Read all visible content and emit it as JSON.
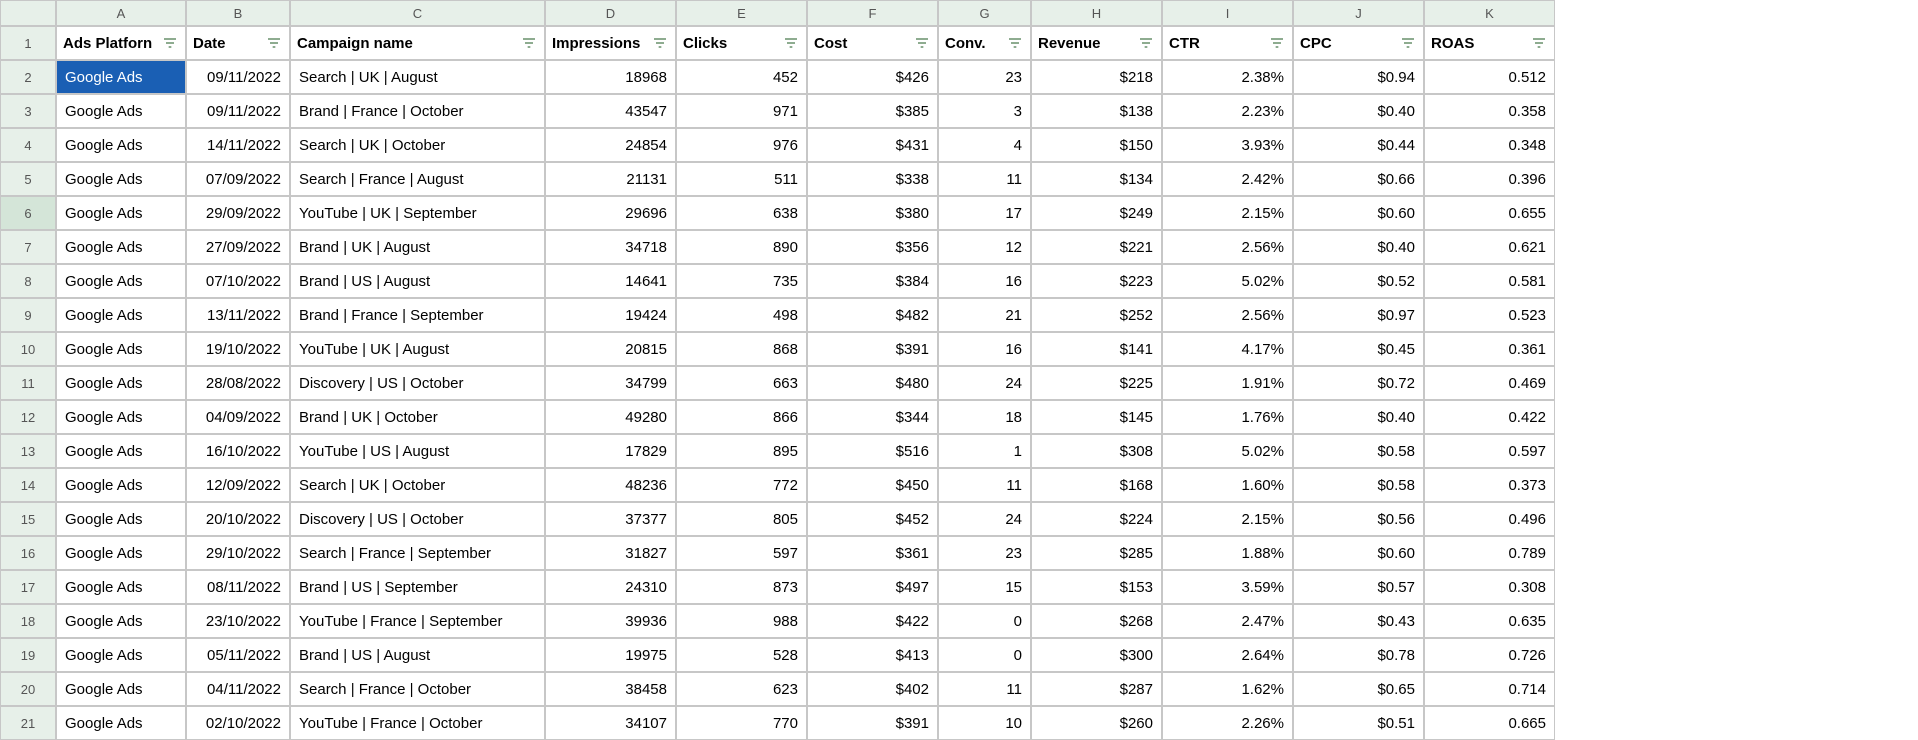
{
  "columns": [
    "A",
    "B",
    "C",
    "D",
    "E",
    "F",
    "G",
    "H",
    "I",
    "J",
    "K"
  ],
  "headers": [
    "Ads Platforn",
    "Date",
    "Campaign name",
    "Impressions",
    "Clicks",
    "Cost",
    "Conv.",
    "Revenue",
    "CTR",
    "CPC",
    "ROAS"
  ],
  "rows": [
    {
      "n": 2,
      "platform": "Google Ads",
      "date": "09/11/2022",
      "campaign": "Search | UK | August",
      "impr": "18968",
      "clicks": "452",
      "cost": "$426",
      "conv": "23",
      "rev": "$218",
      "ctr": "2.38%",
      "cpc": "$0.94",
      "roas": "0.512",
      "selected": true
    },
    {
      "n": 3,
      "platform": "Google Ads",
      "date": "09/11/2022",
      "campaign": "Brand | France | October",
      "impr": "43547",
      "clicks": "971",
      "cost": "$385",
      "conv": "3",
      "rev": "$138",
      "ctr": "2.23%",
      "cpc": "$0.40",
      "roas": "0.358"
    },
    {
      "n": 4,
      "platform": "Google Ads",
      "date": "14/11/2022",
      "campaign": "Search | UK | October",
      "impr": "24854",
      "clicks": "976",
      "cost": "$431",
      "conv": "4",
      "rev": "$150",
      "ctr": "3.93%",
      "cpc": "$0.44",
      "roas": "0.348"
    },
    {
      "n": 5,
      "platform": "Google Ads",
      "date": "07/09/2022",
      "campaign": "Search | France | August",
      "impr": "21131",
      "clicks": "511",
      "cost": "$338",
      "conv": "11",
      "rev": "$134",
      "ctr": "2.42%",
      "cpc": "$0.66",
      "roas": "0.396"
    },
    {
      "n": 6,
      "platform": "Google Ads",
      "date": "29/09/2022",
      "campaign": "YouTube | UK | September",
      "impr": "29696",
      "clicks": "638",
      "cost": "$380",
      "conv": "17",
      "rev": "$249",
      "ctr": "2.15%",
      "cpc": "$0.60",
      "roas": "0.655",
      "rowhighlight": true
    },
    {
      "n": 7,
      "platform": "Google Ads",
      "date": "27/09/2022",
      "campaign": "Brand | UK | August",
      "impr": "34718",
      "clicks": "890",
      "cost": "$356",
      "conv": "12",
      "rev": "$221",
      "ctr": "2.56%",
      "cpc": "$0.40",
      "roas": "0.621"
    },
    {
      "n": 8,
      "platform": "Google Ads",
      "date": "07/10/2022",
      "campaign": "Brand | US | August",
      "impr": "14641",
      "clicks": "735",
      "cost": "$384",
      "conv": "16",
      "rev": "$223",
      "ctr": "5.02%",
      "cpc": "$0.52",
      "roas": "0.581"
    },
    {
      "n": 9,
      "platform": "Google Ads",
      "date": "13/11/2022",
      "campaign": "Brand | France | September",
      "impr": "19424",
      "clicks": "498",
      "cost": "$482",
      "conv": "21",
      "rev": "$252",
      "ctr": "2.56%",
      "cpc": "$0.97",
      "roas": "0.523"
    },
    {
      "n": 10,
      "platform": "Google Ads",
      "date": "19/10/2022",
      "campaign": "YouTube | UK | August",
      "impr": "20815",
      "clicks": "868",
      "cost": "$391",
      "conv": "16",
      "rev": "$141",
      "ctr": "4.17%",
      "cpc": "$0.45",
      "roas": "0.361"
    },
    {
      "n": 11,
      "platform": "Google Ads",
      "date": "28/08/2022",
      "campaign": "Discovery | US | October",
      "impr": "34799",
      "clicks": "663",
      "cost": "$480",
      "conv": "24",
      "rev": "$225",
      "ctr": "1.91%",
      "cpc": "$0.72",
      "roas": "0.469"
    },
    {
      "n": 12,
      "platform": "Google Ads",
      "date": "04/09/2022",
      "campaign": "Brand | UK | October",
      "impr": "49280",
      "clicks": "866",
      "cost": "$344",
      "conv": "18",
      "rev": "$145",
      "ctr": "1.76%",
      "cpc": "$0.40",
      "roas": "0.422"
    },
    {
      "n": 13,
      "platform": "Google Ads",
      "date": "16/10/2022",
      "campaign": "YouTube | US | August",
      "impr": "17829",
      "clicks": "895",
      "cost": "$516",
      "conv": "1",
      "rev": "$308",
      "ctr": "5.02%",
      "cpc": "$0.58",
      "roas": "0.597"
    },
    {
      "n": 14,
      "platform": "Google Ads",
      "date": "12/09/2022",
      "campaign": "Search | UK | October",
      "impr": "48236",
      "clicks": "772",
      "cost": "$450",
      "conv": "11",
      "rev": "$168",
      "ctr": "1.60%",
      "cpc": "$0.58",
      "roas": "0.373"
    },
    {
      "n": 15,
      "platform": "Google Ads",
      "date": "20/10/2022",
      "campaign": "Discovery | US | October",
      "impr": "37377",
      "clicks": "805",
      "cost": "$452",
      "conv": "24",
      "rev": "$224",
      "ctr": "2.15%",
      "cpc": "$0.56",
      "roas": "0.496"
    },
    {
      "n": 16,
      "platform": "Google Ads",
      "date": "29/10/2022",
      "campaign": "Search | France | September",
      "impr": "31827",
      "clicks": "597",
      "cost": "$361",
      "conv": "23",
      "rev": "$285",
      "ctr": "1.88%",
      "cpc": "$0.60",
      "roas": "0.789"
    },
    {
      "n": 17,
      "platform": "Google Ads",
      "date": "08/11/2022",
      "campaign": "Brand | US | September",
      "impr": "24310",
      "clicks": "873",
      "cost": "$497",
      "conv": "15",
      "rev": "$153",
      "ctr": "3.59%",
      "cpc": "$0.57",
      "roas": "0.308"
    },
    {
      "n": 18,
      "platform": "Google Ads",
      "date": "23/10/2022",
      "campaign": "YouTube | France | September",
      "impr": "39936",
      "clicks": "988",
      "cost": "$422",
      "conv": "0",
      "rev": "$268",
      "ctr": "2.47%",
      "cpc": "$0.43",
      "roas": "0.635"
    },
    {
      "n": 19,
      "platform": "Google Ads",
      "date": "05/11/2022",
      "campaign": "Brand | US | August",
      "impr": "19975",
      "clicks": "528",
      "cost": "$413",
      "conv": "0",
      "rev": "$300",
      "ctr": "2.64%",
      "cpc": "$0.78",
      "roas": "0.726"
    },
    {
      "n": 20,
      "platform": "Google Ads",
      "date": "04/11/2022",
      "campaign": "Search | France | October",
      "impr": "38458",
      "clicks": "623",
      "cost": "$402",
      "conv": "11",
      "rev": "$287",
      "ctr": "1.62%",
      "cpc": "$0.65",
      "roas": "0.714"
    },
    {
      "n": 21,
      "platform": "Google Ads",
      "date": "02/10/2022",
      "campaign": "YouTube | France | October",
      "impr": "34107",
      "clicks": "770",
      "cost": "$391",
      "conv": "10",
      "rev": "$260",
      "ctr": "2.26%",
      "cpc": "$0.51",
      "roas": "0.665"
    }
  ]
}
